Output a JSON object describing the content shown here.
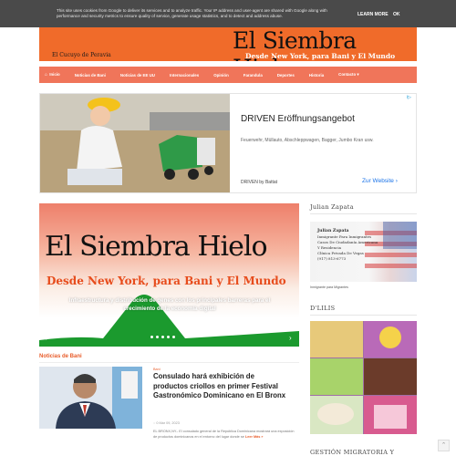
{
  "cookie": {
    "text": "This site uses cookies from Google to deliver its services and to analyze traffic. Your IP address and user-agent are shared with Google along with performance and security metrics to ensure quality of service, generate usage statistics, and to detect and address abuse.",
    "learn_more": "LEARN MORE",
    "ok": "OK"
  },
  "banner": {
    "left_caption": "El Cucuyo de Peravia",
    "title": "El Siembra Hielo",
    "subtitle": "Desde New York, para Bani y El Mundo"
  },
  "nav": {
    "items": [
      "Inicio",
      "Noticias de Bani",
      "Noticias de EE UU",
      "Internacionales",
      "Opinión",
      "Farandula",
      "Deportes",
      "Historia",
      "Contacto"
    ]
  },
  "ad": {
    "title": "DRIVEN Eröffnungsangebot",
    "description": "Feuerwehr, Müllauto, Abschleppwagen, Bagger, Jumbo Kran usw.",
    "brand": "DRIVEN by Battat",
    "link": "Zur Website",
    "badge": "i▷"
  },
  "slider": {
    "title": "El Siembra Hielo",
    "subtitle": "Desde New York, para Bani y El Mundo",
    "caption": "Infraestructura y distribución de genes con los principales barreras para el crecimiento de la economía digital",
    "dot_count": 5
  },
  "section": {
    "title": "Noticias de Bani"
  },
  "article": {
    "category": "Bani",
    "title": "Consulado hará exhibición de productos criollos en primer Festival Gastronómico Dominicano en El Bronx",
    "meta": "0     Mar 09, 2023",
    "text": "EL BRONX,NY.- El consulado general de la República Dominicana mostrará una exposición de productos dominicanos en el entorno del lugar donde se",
    "read_more": "Leer Más »"
  },
  "sidebar": {
    "heading1": "Julian Zapata",
    "caption1": "Julian Zapata",
    "card_lines": [
      "Julian Zapata",
      "Inmigrante Para Inmigrantes",
      "Casos De Ciudadanía Americana",
      "Y Residencia",
      "Clínica Privada De Vegas",
      "(917) 813-6773"
    ],
    "image_caption": "Inmigrante para Migrantes",
    "heading2": "D'LILIS",
    "heading3": "GESTIÓN MIGRATORIA Y"
  },
  "colors": {
    "orange": "#f06b2a",
    "nav": "#f0755a",
    "accent": "#e85c2a"
  }
}
